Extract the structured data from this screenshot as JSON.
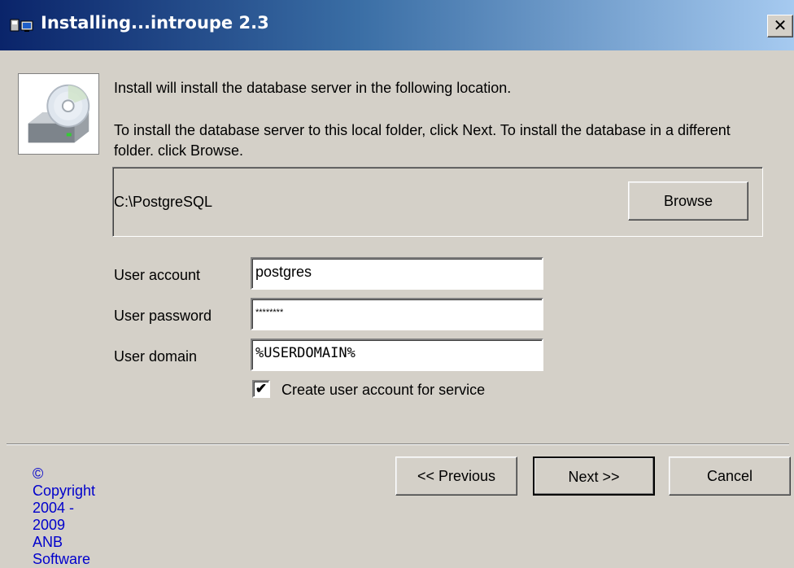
{
  "window": {
    "title": "Installing...introupe 2.3",
    "close_label": "✕"
  },
  "intro": {
    "line1": "Install will install the database server in the following location.",
    "line2": "To install the database server to this local folder, click Next. To install the database in a different folder. click Browse."
  },
  "folder": {
    "path": "C:\\PostgreSQL",
    "browse_label": "Browse"
  },
  "fields": {
    "account_label": "User account",
    "account_value": "postgres",
    "password_label": "User password",
    "password_value": "********",
    "domain_label": "User domain",
    "domain_value": "%USERDOMAIN%"
  },
  "checkbox": {
    "label": "Create user account for service",
    "checked": true
  },
  "footer": {
    "copyright": "© Copyright 2004 - 2009 ANB Software",
    "previous_label": "<< Previous",
    "next_label": "Next >>",
    "cancel_label": "Cancel"
  },
  "icons": {
    "title_icon": "installer-icon",
    "product_icon": "cd-drive-icon"
  },
  "colors": {
    "title_start": "#0a246a",
    "title_end": "#a6caf0",
    "face": "#d4d0c8",
    "link": "#0000cc"
  }
}
